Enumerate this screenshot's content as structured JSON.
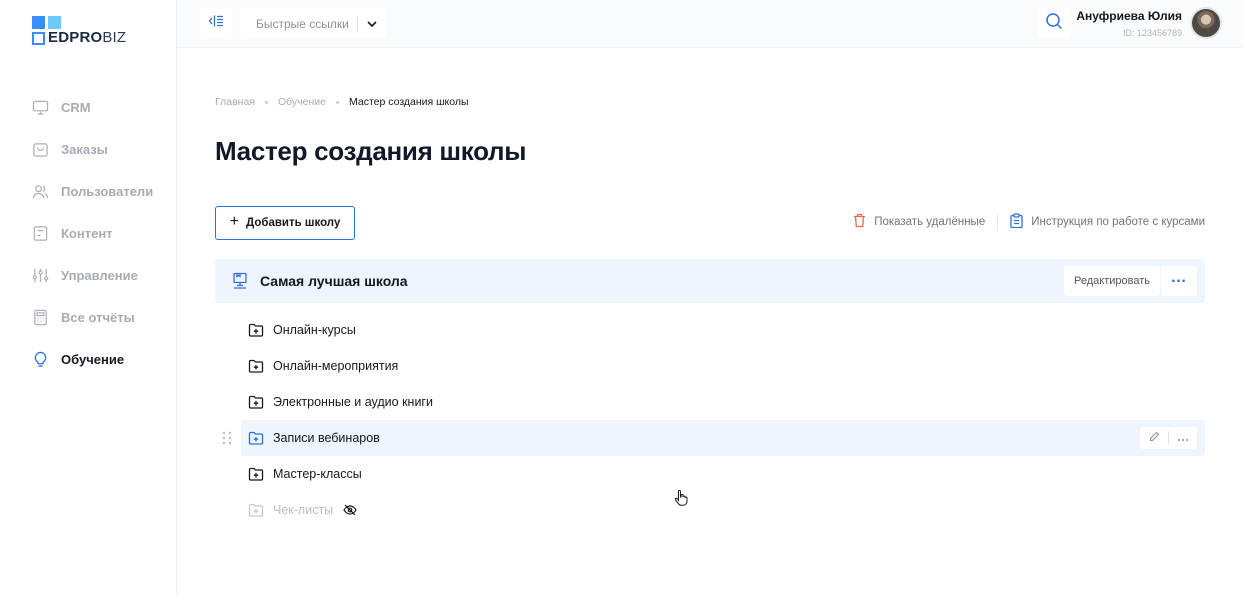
{
  "logo": {
    "bold": "EDPRO",
    "light": "BIZ"
  },
  "sidebar": {
    "items": [
      {
        "label": "CRM",
        "icon": "monitor-icon",
        "active": false
      },
      {
        "label": "Заказы",
        "icon": "bag-icon",
        "active": false
      },
      {
        "label": "Пользователи",
        "icon": "users-icon",
        "active": false
      },
      {
        "label": "Контент",
        "icon": "content-icon",
        "active": false
      },
      {
        "label": "Управление",
        "icon": "sliders-icon",
        "active": false
      },
      {
        "label": "Все отчёты",
        "icon": "calculator-icon",
        "active": false
      },
      {
        "label": "Обучение",
        "icon": "lightbulb-icon",
        "active": true
      }
    ]
  },
  "topbar": {
    "quick_links": "Быстрые ссылки",
    "user_name": "Ануфриева Юлия",
    "user_id": "ID: 123456789"
  },
  "breadcrumb": {
    "home": "Главная",
    "section": "Обучение",
    "current": "Мастер создания школы"
  },
  "page": {
    "title": "Мастер создания школы",
    "add_school": "Добавить школу",
    "show_deleted": "Показать удалённые",
    "instructions": "Инструкция по работе с курсами"
  },
  "school": {
    "title": "Самая лучшая школа",
    "edit_label": "Редактировать",
    "folders": [
      {
        "label": "Онлайн-курсы",
        "state": "normal"
      },
      {
        "label": "Онлайн-мероприятия",
        "state": "normal"
      },
      {
        "label": "Электронные и аудио книги",
        "state": "normal"
      },
      {
        "label": "Записи вебинаров",
        "state": "hover"
      },
      {
        "label": "Мастер-классы",
        "state": "normal"
      },
      {
        "label": "Чек-листы",
        "state": "hidden"
      }
    ]
  },
  "colors": {
    "accent": "#2f6fd6",
    "highlight": "#eef5fd",
    "danger": "#f0684a"
  }
}
